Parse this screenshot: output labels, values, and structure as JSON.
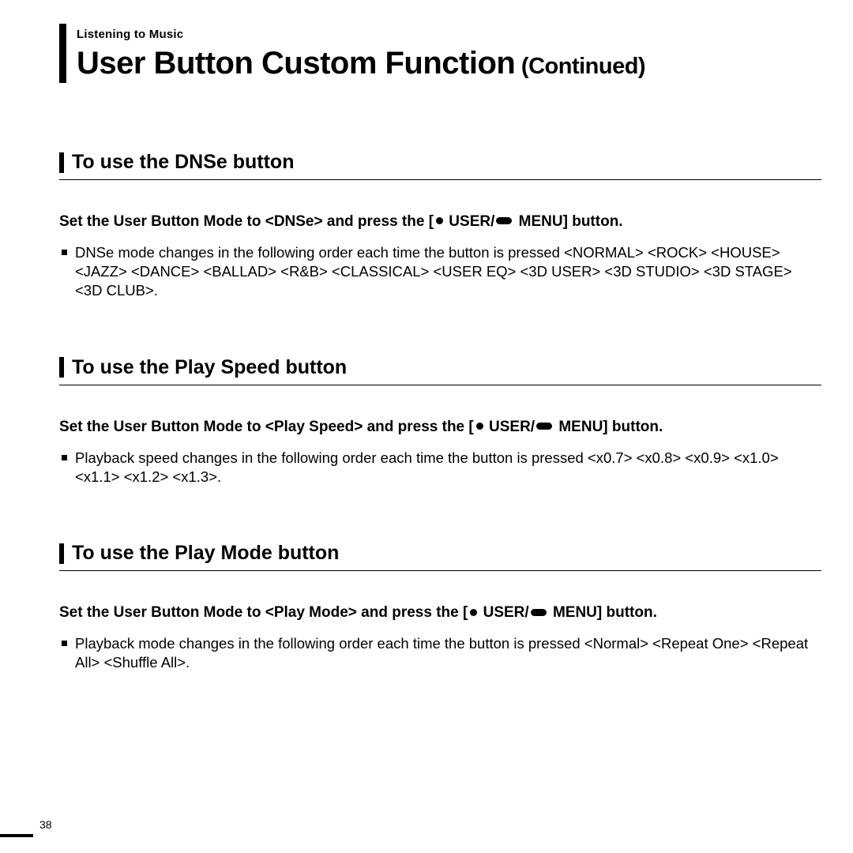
{
  "chapter": "Listening to Music",
  "title_main": "User Button Custom Function",
  "title_suffix": " (Continued)",
  "sections": [
    {
      "title": "To use the DNSe button",
      "instruction_pre": "Set the User Button Mode to <DNSe> and press the [",
      "instruction_mid": " USER/",
      "instruction_post": " MENU] button.",
      "bullet": "DNSe mode changes in the following order each time the button is pressed <NORMAL> <ROCK> <HOUSE> <JAZZ> <DANCE> <BALLAD> <R&B> <CLASSICAL> <USER EQ> <3D USER> <3D STUDIO> <3D STAGE> <3D CLUB>."
    },
    {
      "title": "To use the Play Speed button",
      "instruction_pre": "Set the User Button Mode to <Play Speed> and press the [",
      "instruction_mid": " USER/",
      "instruction_post": " MENU] button.",
      "bullet": "Playback speed changes in the following order each time the button is pressed <x0.7> <x0.8> <x0.9> <x1.0> <x1.1> <x1.2> <x1.3>."
    },
    {
      "title": "To use the Play Mode button",
      "instruction_pre": "Set the User Button Mode to <Play Mode> and press the [",
      "instruction_mid": " USER/",
      "instruction_post": " MENU] button.",
      "bullet": "Playback mode changes in the following order each time the button is pressed <Normal> <Repeat One> <Repeat All> <Shuffle All>."
    }
  ],
  "page_number": "38"
}
